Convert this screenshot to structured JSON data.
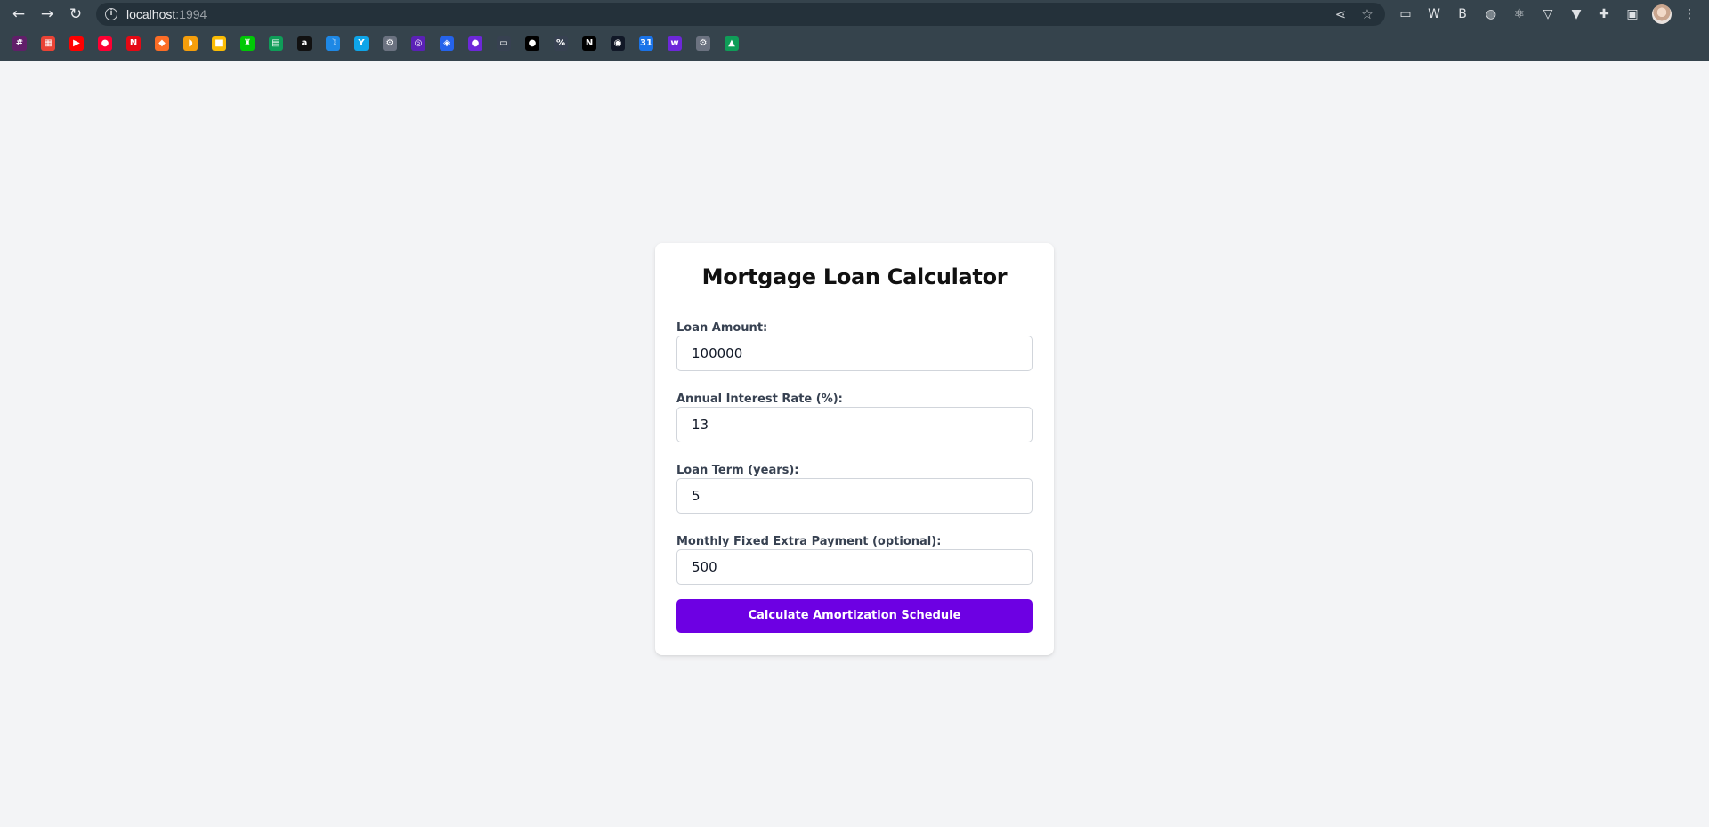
{
  "browser": {
    "url_host": "localhost",
    "url_port": ":1994",
    "nav": {
      "back_icon": "arrow-left-icon",
      "forward_icon": "arrow-right-icon",
      "reload_icon": "reload-icon",
      "back_glyph": "←",
      "forward_glyph": "→",
      "reload_glyph": "↻"
    },
    "info_glyph": "i",
    "share_glyph": "⋖",
    "star_glyph": "☆",
    "menu_glyph": "⋮",
    "puzzle_glyph": "✚",
    "sidepanel_glyph": "▣",
    "bookmarks": [
      {
        "icon": "slack-icon",
        "color": "#611f69",
        "glyph": "#"
      },
      {
        "icon": "google-apps-icon",
        "color": "#ea4335",
        "glyph": "▦"
      },
      {
        "icon": "youtube-icon",
        "color": "#ff0000",
        "glyph": "▶"
      },
      {
        "icon": "youtube-music-icon",
        "color": "#ff0033",
        "glyph": "●"
      },
      {
        "icon": "netflix-icon",
        "color": "#e50914",
        "glyph": "N"
      },
      {
        "icon": "gitlab-icon",
        "color": "#fc6d26",
        "glyph": "◆"
      },
      {
        "icon": "bread-icon",
        "color": "#f59e0b",
        "glyph": "◗"
      },
      {
        "icon": "keep-icon",
        "color": "#fbbc04",
        "glyph": "■"
      },
      {
        "icon": "robinhood-icon",
        "color": "#00c805",
        "glyph": "♜"
      },
      {
        "icon": "sheets-icon",
        "color": "#0f9d58",
        "glyph": "▤"
      },
      {
        "icon": "amazon-icon",
        "color": "#111111",
        "glyph": "a"
      },
      {
        "icon": "crescent-icon",
        "color": "#1e88e5",
        "glyph": "☽"
      },
      {
        "icon": "y-icon",
        "color": "#0ea5e9",
        "glyph": "Y"
      },
      {
        "icon": "gear-icon",
        "color": "#6b7280",
        "glyph": "⚙"
      },
      {
        "icon": "calendar-purple-icon",
        "color": "#5b21b6",
        "glyph": "◎"
      },
      {
        "icon": "diamond-icon",
        "color": "#2563eb",
        "glyph": "◈"
      },
      {
        "icon": "purple-orb-icon",
        "color": "#6d28d9",
        "glyph": "●"
      },
      {
        "icon": "tab-icon",
        "color": "#374151",
        "glyph": "▭"
      },
      {
        "icon": "medium-icon",
        "color": "#000000",
        "glyph": "●"
      },
      {
        "icon": "percent-icon",
        "color": "#374151",
        "glyph": "%"
      },
      {
        "icon": "notion-icon",
        "color": "#000000",
        "glyph": "N"
      },
      {
        "icon": "globe-icon",
        "color": "#111827",
        "glyph": "◉"
      },
      {
        "icon": "calendar-icon",
        "color": "#1a73e8",
        "glyph": "31"
      },
      {
        "icon": "web3-icon",
        "color": "#6d28d9",
        "glyph": "w"
      },
      {
        "icon": "settings-icon",
        "color": "#6b7280",
        "glyph": "⚙"
      },
      {
        "icon": "drive-icon",
        "color": "#0f9d58",
        "glyph": "▲"
      }
    ],
    "extensions": [
      {
        "icon": "terminal-icon",
        "glyph": "▭"
      },
      {
        "icon": "w-icon",
        "glyph": "W"
      },
      {
        "icon": "bitwarden-icon",
        "glyph": "B"
      },
      {
        "icon": "mouse-icon",
        "glyph": "◍"
      },
      {
        "icon": "react-icon",
        "glyph": "⚛"
      },
      {
        "icon": "vue-icon",
        "glyph": "▽"
      },
      {
        "icon": "vuetify-icon",
        "glyph": "▼"
      }
    ]
  },
  "page": {
    "title": "Mortgage Loan Calculator",
    "fields": [
      {
        "label": "Loan Amount:",
        "value": "100000"
      },
      {
        "label": "Annual Interest Rate (%):",
        "value": "13"
      },
      {
        "label": "Loan Term (years):",
        "value": "5"
      },
      {
        "label": "Monthly Fixed Extra Payment (optional):",
        "value": "500"
      }
    ],
    "submit_label": "Calculate Amortization Schedule",
    "accent_color": "#6d00e3"
  }
}
